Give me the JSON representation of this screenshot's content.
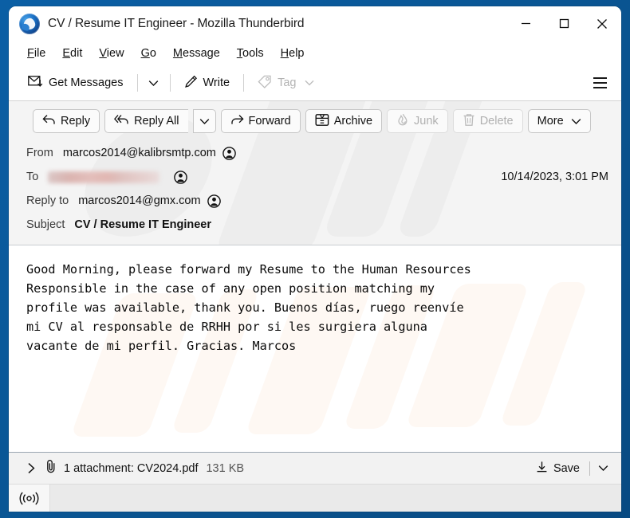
{
  "window": {
    "title": "CV / Resume IT Engineer - Mozilla Thunderbird",
    "app_icon": "thunderbird-logo",
    "controls": {
      "minimize": "minimize-icon",
      "maximize": "maximize-icon",
      "close": "close-icon"
    },
    "frame_color": "#0b5fa5"
  },
  "menubar": {
    "items": [
      {
        "label": "File",
        "accel": "F"
      },
      {
        "label": "Edit",
        "accel": "E"
      },
      {
        "label": "View",
        "accel": "V"
      },
      {
        "label": "Go",
        "accel": "G"
      },
      {
        "label": "Message",
        "accel": "M"
      },
      {
        "label": "Tools",
        "accel": "T"
      },
      {
        "label": "Help",
        "accel": "H"
      }
    ]
  },
  "toolbar": {
    "get_messages_label": "Get Messages",
    "get_messages_icon": "envelope-download-icon",
    "get_messages_caret": "chevron-down-icon",
    "write_label": "Write",
    "write_icon": "pencil-icon",
    "tag_label": "Tag",
    "tag_icon": "tag-icon",
    "tag_disabled": true,
    "tag_caret": "chevron-down-icon",
    "app_menu_icon": "hamburger-menu-icon"
  },
  "message_actions": [
    {
      "label": "Reply",
      "icon": "reply-arrow-icon",
      "disabled": false,
      "split": false
    },
    {
      "label": "Reply All",
      "icon": "reply-all-arrow-icon",
      "disabled": false,
      "split": true
    },
    {
      "label": "Forward",
      "icon": "forward-arrow-icon",
      "disabled": false,
      "split": false
    },
    {
      "label": "Archive",
      "icon": "archive-box-icon",
      "disabled": false,
      "split": false
    },
    {
      "label": "Junk",
      "icon": "junk-flame-icon",
      "disabled": true,
      "split": false
    },
    {
      "label": "More",
      "icon": "chevron-down-icon",
      "disabled": false,
      "split": false
    }
  ],
  "delete_button": {
    "label": "Delete",
    "icon": "trash-icon",
    "disabled": true
  },
  "headers": {
    "from_label": "From",
    "from_value": "marcos2014@kalibrsmtp.com",
    "to_label": "To",
    "to_value_redacted": true,
    "reply_to_label": "Reply to",
    "reply_to_value": "marcos2014@gmx.com",
    "subject_label": "Subject",
    "subject_value": "CV / Resume IT Engineer",
    "date": "10/14/2023, 3:01 PM",
    "contact_icon": "contact-avatar-icon"
  },
  "body": {
    "text": "Good Morning, please forward my Resume to the Human Resources\nResponsible in the case of any open position matching my\nprofile was available, thank you. Buenos días, ruego reenvíe\nmi CV al responsable de RRHH por si les surgiera alguna\nvacante de mi perfil. Gracias. Marcos"
  },
  "attachment": {
    "expander_icon": "chevron-right-icon",
    "paperclip_icon": "paperclip-icon",
    "label": "1 attachment: CV2024.pdf",
    "size": "131 KB",
    "save_label": "Save",
    "save_icon": "download-icon",
    "save_caret": "chevron-down-icon"
  },
  "statusbar": {
    "connection_icon": "broadcast-online-icon"
  }
}
